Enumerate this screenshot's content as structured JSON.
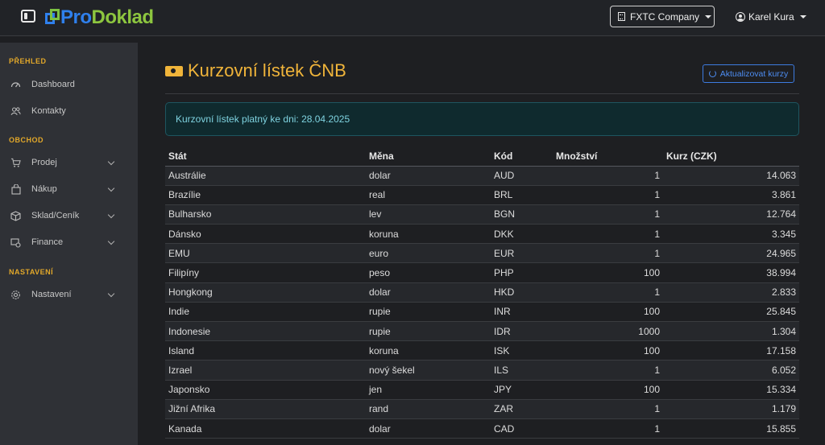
{
  "navbar": {
    "brand_pro": "Pro",
    "brand_doklad": "Doklad",
    "company": "FXTC Company",
    "user": "Karel Kura"
  },
  "sidebar": {
    "sections": [
      {
        "title": "PŘEHLED",
        "items": [
          {
            "label": "Dashboard",
            "icon": "dashboard-icon"
          },
          {
            "label": "Kontakty",
            "icon": "contacts-icon"
          }
        ]
      },
      {
        "title": "OBCHOD",
        "items": [
          {
            "label": "Prodej",
            "icon": "cart-icon"
          },
          {
            "label": "Nákup",
            "icon": "bag-icon"
          },
          {
            "label": "Sklad/Ceník",
            "icon": "box-icon"
          },
          {
            "label": "Finance",
            "icon": "finance-icon"
          }
        ]
      },
      {
        "title": "NASTAVENÍ",
        "items": [
          {
            "label": "Nastavení",
            "icon": "gear-icon"
          }
        ]
      }
    ]
  },
  "page": {
    "title": "Kurzovní lístek ČNB",
    "update_button": "Aktualizovat kurzy",
    "alert": "Kurzovní lístek platný ke dni: 28.04.2025"
  },
  "table": {
    "headers": [
      "Stát",
      "Měna",
      "Kód",
      "Množství",
      "Kurz (CZK)"
    ],
    "rows": [
      [
        "Austrálie",
        "dolar",
        "AUD",
        "1",
        "14.063"
      ],
      [
        "Brazílie",
        "real",
        "BRL",
        "1",
        "3.861"
      ],
      [
        "Bulharsko",
        "lev",
        "BGN",
        "1",
        "12.764"
      ],
      [
        "Dánsko",
        "koruna",
        "DKK",
        "1",
        "3.345"
      ],
      [
        "EMU",
        "euro",
        "EUR",
        "1",
        "24.965"
      ],
      [
        "Filipíny",
        "peso",
        "PHP",
        "100",
        "38.994"
      ],
      [
        "Hongkong",
        "dolar",
        "HKD",
        "1",
        "2.833"
      ],
      [
        "Indie",
        "rupie",
        "INR",
        "100",
        "25.845"
      ],
      [
        "Indonesie",
        "rupie",
        "IDR",
        "1000",
        "1.304"
      ],
      [
        "Island",
        "koruna",
        "ISK",
        "100",
        "17.158"
      ],
      [
        "Izrael",
        "nový šekel",
        "ILS",
        "1",
        "6.052"
      ],
      [
        "Japonsko",
        "jen",
        "JPY",
        "100",
        "15.334"
      ],
      [
        "Jižní Afrika",
        "rand",
        "ZAR",
        "1",
        "1.179"
      ],
      [
        "Kanada",
        "dolar",
        "CAD",
        "1",
        "15.855"
      ]
    ]
  },
  "colors": {
    "accent": "#f0b43a",
    "link": "#4d8cf0",
    "alert_text": "#7fd3e0"
  }
}
